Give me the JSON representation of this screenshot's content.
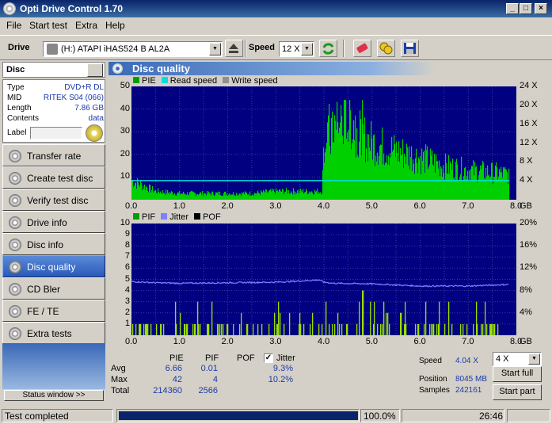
{
  "window": {
    "title": "Opti Drive Control 1.70",
    "minimize": "_",
    "maximize": "□",
    "close": "×"
  },
  "menu": [
    "File",
    "Start test",
    "Extra",
    "Help"
  ],
  "toolbar": {
    "drive_label": "Drive",
    "drive_value": "(H:)   ATAPI iHAS524   B AL2A",
    "speed_label": "Speed",
    "speed_value": "12 X"
  },
  "disc": {
    "header": "Disc",
    "rows": [
      {
        "key": "Type",
        "value": "DVD+R DL"
      },
      {
        "key": "MID",
        "value": "RITEK S04 (066)"
      },
      {
        "key": "Length",
        "value": "7.86 GB"
      },
      {
        "key": "Contents",
        "value": "data"
      }
    ],
    "label_key": "Label"
  },
  "nav": [
    {
      "name": "transfer-rate",
      "label": "Transfer rate",
      "active": false
    },
    {
      "name": "create-test-disc",
      "label": "Create test disc",
      "active": false
    },
    {
      "name": "verify-test-disc",
      "label": "Verify test disc",
      "active": false
    },
    {
      "name": "drive-info",
      "label": "Drive info",
      "active": false
    },
    {
      "name": "disc-info",
      "label": "Disc info",
      "active": false
    },
    {
      "name": "disc-quality",
      "label": "Disc quality",
      "active": true
    },
    {
      "name": "cd-bler",
      "label": "CD Bler",
      "active": false
    },
    {
      "name": "fe-te",
      "label": "FE / TE",
      "active": false
    },
    {
      "name": "extra-tests",
      "label": "Extra tests",
      "active": false
    }
  ],
  "status_window_button": "Status window >>",
  "panel_title": "Disc quality",
  "colors": {
    "plot_bg": "#000080",
    "bars": "#00d000",
    "read_speed": "#00e0e0",
    "jitter": "#8080ff",
    "pif": "#9adf00"
  },
  "chart_data": [
    {
      "type": "bar",
      "legend": [
        "PIE",
        "Read speed",
        "Write speed"
      ],
      "xlim": [
        0,
        8
      ],
      "xunit": "GB",
      "xticks": [
        "0.0",
        "1.0",
        "2.0",
        "3.0",
        "4.0",
        "5.0",
        "6.0",
        "7.0",
        "8.0"
      ],
      "ylim": [
        0,
        50
      ],
      "yticks": [
        "10",
        "20",
        "30",
        "40",
        "50"
      ],
      "y2ticks": [
        "4 X",
        "8 X",
        "12 X",
        "16 X",
        "20 X",
        "24 X"
      ],
      "y2lim": [
        0,
        24
      ],
      "pie_profile": {
        "x": [
          0.0,
          0.2,
          0.5,
          1.0,
          1.5,
          2.0,
          2.5,
          3.0,
          3.5,
          3.95,
          4.0,
          4.2,
          4.4,
          4.5,
          4.6,
          4.8,
          5.0,
          5.5,
          6.0,
          6.5,
          7.0,
          7.5,
          7.85
        ],
        "y": [
          9,
          7,
          4,
          3,
          3,
          3,
          3,
          4,
          4,
          4,
          27,
          32,
          37,
          38,
          35,
          30,
          27,
          23,
          20,
          16,
          14,
          13,
          12
        ]
      },
      "read_speed_x": 4.04
    },
    {
      "type": "bar",
      "legend": [
        "PIF",
        "Jitter",
        "POF"
      ],
      "xlim": [
        0,
        8
      ],
      "xunit": "GB",
      "xticks": [
        "0.0",
        "1.0",
        "2.0",
        "3.0",
        "4.0",
        "5.0",
        "6.0",
        "7.0",
        "8.0"
      ],
      "ylim": [
        0,
        10
      ],
      "yticks": [
        "1",
        "2",
        "3",
        "4",
        "5",
        "6",
        "7",
        "8",
        "9",
        "10"
      ],
      "y2ticks": [
        "4%",
        "8%",
        "12%",
        "16%",
        "20%"
      ],
      "y2lim": [
        0,
        20
      ],
      "jitter": {
        "x": [
          0.0,
          0.5,
          1.0,
          2.0,
          3.0,
          3.5,
          3.9,
          4.0,
          4.2,
          5.0,
          6.0,
          7.0,
          7.85
        ],
        "y": [
          9.6,
          9.4,
          9.3,
          9.4,
          9.5,
          9.7,
          9.9,
          9.5,
          9.3,
          9.2,
          8.8,
          8.8,
          9.1
        ]
      },
      "pif_peak": {
        "x": 4.8,
        "y": 4
      }
    }
  ],
  "stats": {
    "headers": [
      "PIE",
      "PIF",
      "POF",
      "Jitter"
    ],
    "rows": [
      {
        "label": "Avg",
        "pie": "6.66",
        "pif": "0.01",
        "jitter": "9.3%"
      },
      {
        "label": "Max",
        "pie": "42",
        "pif": "4",
        "jitter": "10.2%"
      },
      {
        "label": "Total",
        "pie": "214360",
        "pif": "2566",
        "jitter": ""
      }
    ],
    "jitter_checked": "✓"
  },
  "info": {
    "speed_label": "Speed",
    "speed_value": "4.04 X",
    "position_label": "Position",
    "position_value": "8045 MB",
    "samples_label": "Samples",
    "samples_value": "242161",
    "speed_select": "4 X",
    "start_full": "Start full",
    "start_part": "Start part"
  },
  "statusbar": {
    "text": "Test completed",
    "progress": "100.0%",
    "progress_fraction": 1.0,
    "time": "26:46"
  }
}
